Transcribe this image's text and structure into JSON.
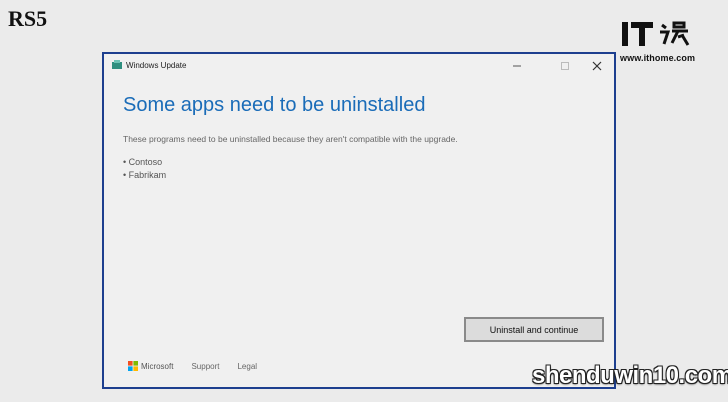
{
  "slide": {
    "label": "RS5"
  },
  "logo": {
    "url": "www.ithome.com",
    "mark_text": "IT之家"
  },
  "window": {
    "title": "Windows Update",
    "controls": [
      "minimize",
      "maximize",
      "close"
    ],
    "heading": "Some apps need to be uninstalled",
    "description": "These programs need to be uninstalled because they aren't compatible with the upgrade.",
    "apps": [
      "• Contoso",
      "• Fabrikam"
    ],
    "primary_button": "Uninstall and continue",
    "footer": {
      "brand": "Microsoft",
      "links": [
        "Support",
        "Legal"
      ]
    }
  },
  "watermark": {
    "text": "shenduwin10.com"
  },
  "colors": {
    "heading": "#1a6cb8",
    "window_border": "#1d3f8f",
    "button_bg": "#dcdcdc",
    "background": "#ebebeb"
  }
}
